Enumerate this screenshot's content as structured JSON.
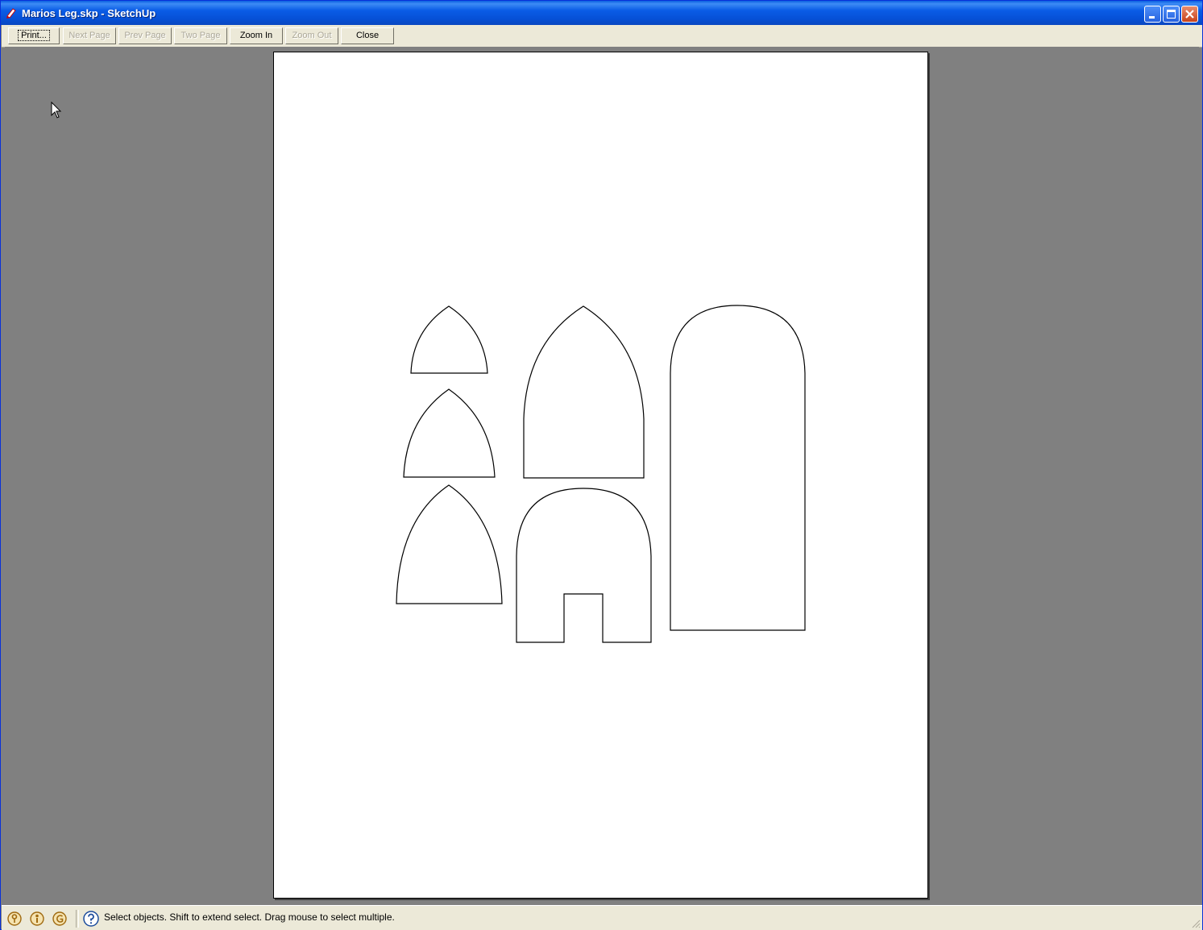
{
  "window": {
    "title": "Marios Leg.skp - SketchUp"
  },
  "toolbar": {
    "print": "Print...",
    "next_page": "Next Page",
    "prev_page": "Prev Page",
    "two_page": "Two Page",
    "zoom_in": "Zoom In",
    "zoom_out": "Zoom Out",
    "close": "Close"
  },
  "status": {
    "text": "Select objects. Shift to extend select. Drag mouse to select multiple.",
    "icons": [
      "geo-location-icon",
      "credits-icon",
      "user-account-icon",
      "help-icon"
    ]
  },
  "colors": {
    "title_bar": "#0a5ce6",
    "background": "#808080",
    "chrome": "#ece9d8"
  }
}
